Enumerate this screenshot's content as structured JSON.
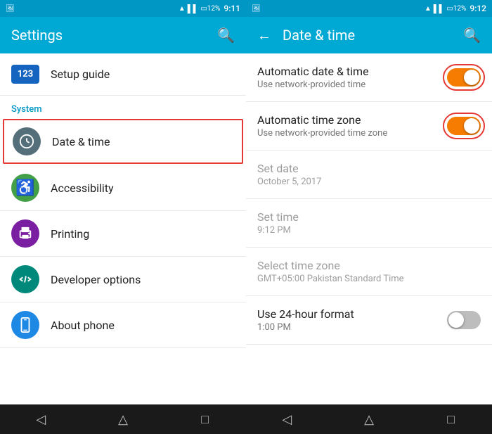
{
  "left_panel": {
    "status_bar": {
      "time": "9:11",
      "wifi_icon": "📶",
      "signal_icon": "📶",
      "battery": "12%"
    },
    "toolbar": {
      "title": "Settings",
      "search_label": "🔍"
    },
    "setup_item": {
      "badge": "123",
      "label": "Setup guide"
    },
    "system_section": {
      "header": "System",
      "items": [
        {
          "id": "date-time",
          "label": "Date & time",
          "icon": "🕐",
          "icon_bg": "grey",
          "highlighted": true
        },
        {
          "id": "accessibility",
          "label": "Accessibility",
          "icon": "♿",
          "icon_bg": "green",
          "highlighted": false
        },
        {
          "id": "printing",
          "label": "Printing",
          "icon": "🖨",
          "icon_bg": "purple",
          "highlighted": false
        },
        {
          "id": "developer",
          "label": "Developer options",
          "icon": "◈",
          "icon_bg": "teal",
          "highlighted": false
        },
        {
          "id": "about",
          "label": "About phone",
          "icon": "📱",
          "icon_bg": "phone",
          "highlighted": false
        }
      ]
    },
    "nav": {
      "back": "◁",
      "home": "△",
      "recent": "□"
    }
  },
  "right_panel": {
    "status_bar": {
      "time": "9:12",
      "wifi_icon": "📶",
      "battery": "12%"
    },
    "toolbar": {
      "back_label": "←",
      "title": "Date & time",
      "search_label": "🔍"
    },
    "settings": [
      {
        "id": "auto-date-time",
        "title": "Automatic date & time",
        "subtitle": "Use network-provided time",
        "type": "toggle",
        "value": true,
        "highlighted_ring": true
      },
      {
        "id": "auto-timezone",
        "title": "Automatic time zone",
        "subtitle": "Use network-provided time zone",
        "type": "toggle",
        "value": true,
        "highlighted_ring": true
      },
      {
        "id": "set-date",
        "title": "Set date",
        "value": "October 5, 2017",
        "type": "static",
        "disabled": true
      },
      {
        "id": "set-time",
        "title": "Set time",
        "value": "9:12 PM",
        "type": "static",
        "disabled": true
      },
      {
        "id": "timezone",
        "title": "Select time zone",
        "value": "GMT+05:00 Pakistan Standard Time",
        "type": "static",
        "disabled": true
      },
      {
        "id": "24hour",
        "title": "Use 24-hour format",
        "subtitle": "1:00 PM",
        "type": "toggle",
        "value": false,
        "highlighted_ring": false
      }
    ],
    "nav": {
      "back": "◁",
      "home": "△",
      "recent": "□"
    }
  }
}
